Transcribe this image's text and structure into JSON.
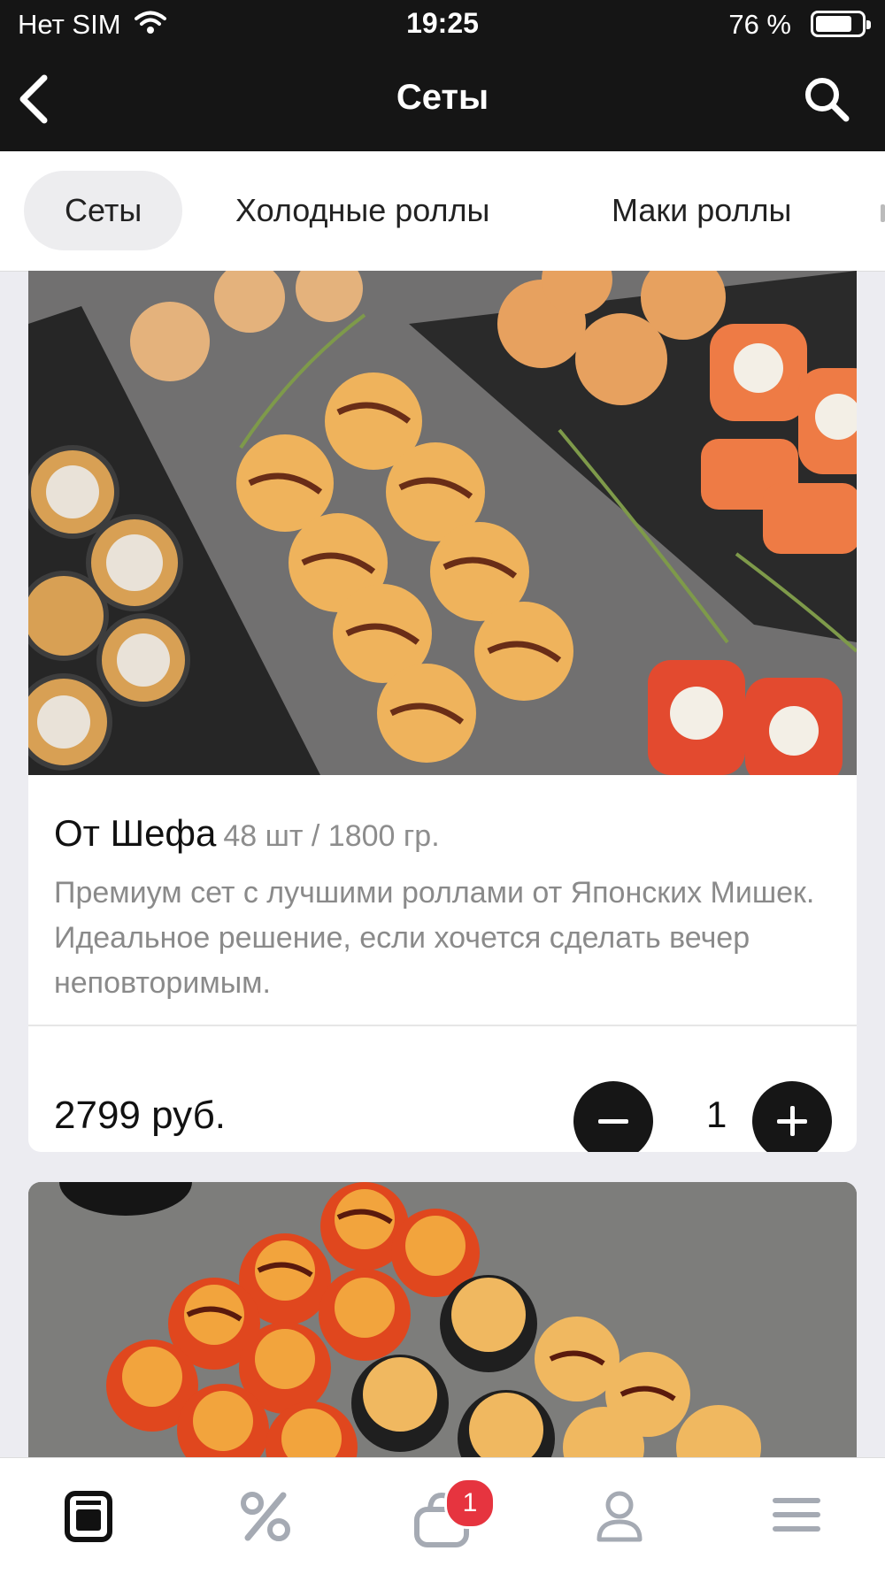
{
  "status_bar": {
    "carrier": "Нет SIM",
    "time": "19:25",
    "battery": "76 %"
  },
  "header": {
    "title": "Сеты"
  },
  "tabs": [
    {
      "label": "Сеты",
      "active": true
    },
    {
      "label": "Холодные роллы",
      "active": false
    },
    {
      "label": "Маки роллы",
      "active": false
    }
  ],
  "products": [
    {
      "name": "От Шефа",
      "meta": "48 шт / 1800 гр.",
      "description": "Премиум сет с лучшими роллами от Японских Мишек. Идеальное решение, если хочется сделать вечер неповторимым.",
      "price": "2799 руб.",
      "quantity": "1"
    }
  ],
  "bottom_nav": {
    "items": [
      "menu-icon",
      "discount-icon",
      "cart-icon",
      "profile-icon",
      "more-icon"
    ],
    "cart_badge": "1"
  },
  "colors": {
    "header_bg": "#151515",
    "badge": "#e6343f",
    "page_bg": "#ececf1"
  }
}
